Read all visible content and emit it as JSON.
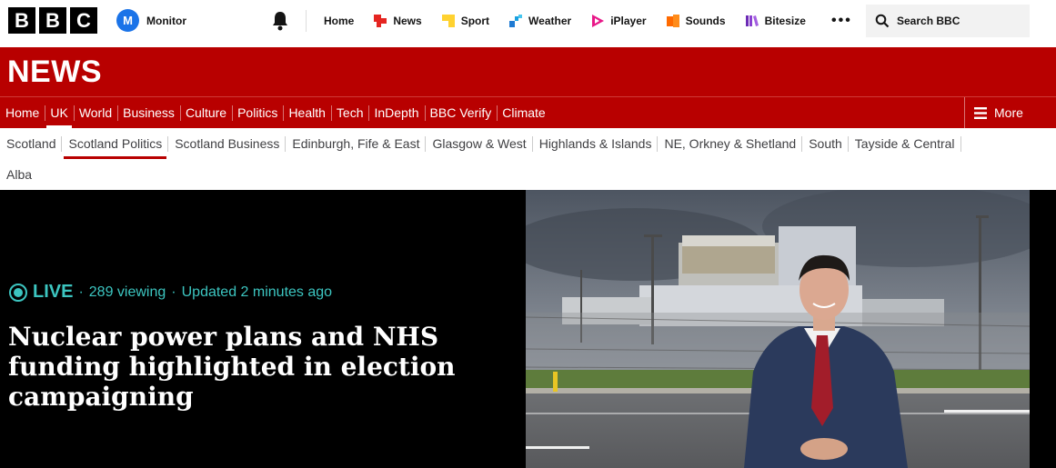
{
  "brand": {
    "logo_letters": [
      "B",
      "B",
      "C"
    ]
  },
  "account": {
    "initial": "M",
    "name": "Monitor"
  },
  "top_nav": [
    {
      "label": "Home",
      "icon": "none"
    },
    {
      "label": "News",
      "icon": "news-icon",
      "color": "#e52521"
    },
    {
      "label": "Sport",
      "icon": "sport-icon",
      "color": "#ffd230"
    },
    {
      "label": "Weather",
      "icon": "weather-icon",
      "color": "#1f7bd3"
    },
    {
      "label": "iPlayer",
      "icon": "iplayer-icon",
      "color": "#e81888"
    },
    {
      "label": "Sounds",
      "icon": "sounds-icon",
      "color": "#ff6a00"
    },
    {
      "label": "Bitesize",
      "icon": "bitesize-icon",
      "color": "#6c2bb5"
    }
  ],
  "search": {
    "label": "Search BBC"
  },
  "news_title": "NEWS",
  "primary_nav": [
    {
      "label": "Home",
      "active": false
    },
    {
      "label": "UK",
      "active": true
    },
    {
      "label": "World",
      "active": false
    },
    {
      "label": "Business",
      "active": false
    },
    {
      "label": "Culture",
      "active": false
    },
    {
      "label": "Politics",
      "active": false
    },
    {
      "label": "Health",
      "active": false
    },
    {
      "label": "Tech",
      "active": false
    },
    {
      "label": "InDepth",
      "active": false
    },
    {
      "label": "BBC Verify",
      "active": false
    },
    {
      "label": "Climate",
      "active": false
    }
  ],
  "primary_more": "More",
  "secondary_nav": [
    {
      "label": "Scotland",
      "active": false
    },
    {
      "label": "Scotland Politics",
      "active": true
    },
    {
      "label": "Scotland Business",
      "active": false
    },
    {
      "label": "Edinburgh, Fife & East",
      "active": false
    },
    {
      "label": "Glasgow & West",
      "active": false
    },
    {
      "label": "Highlands & Islands",
      "active": false
    },
    {
      "label": "NE, Orkney & Shetland",
      "active": false
    },
    {
      "label": "South",
      "active": false
    },
    {
      "label": "Tayside & Central",
      "active": false
    },
    {
      "label": "Alba",
      "active": false
    }
  ],
  "hero": {
    "live_label": "LIVE",
    "viewing": "289 viewing",
    "updated": "Updated 2 minutes ago",
    "headline": "Nuclear power plans and NHS funding highlighted in election campaigning"
  },
  "colors": {
    "bbc_red": "#b80000",
    "live_teal": "#3cc5c0"
  }
}
